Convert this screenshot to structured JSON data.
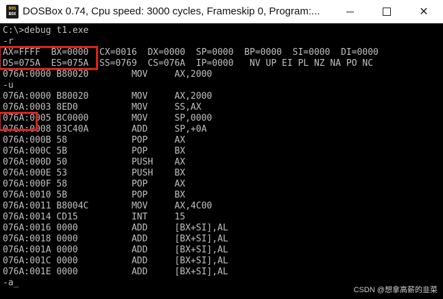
{
  "window": {
    "title": "DOSBox 0.74, Cpu speed:     3000 cycles, Frameskip  0, Program:...",
    "icon_top": "DOS",
    "icon_bottom": "BOX",
    "icon": "dosbox-app-icon",
    "controls": {
      "minimize_icon": "minimize-icon",
      "maximize_icon": "maximize-icon",
      "close_icon": "close-icon",
      "close_glyph": "✕"
    }
  },
  "console_lines": [
    "C:\\>debug t1.exe",
    "-r",
    "AX=FFFF  BX=0000  CX=0016  DX=0000  SP=0000  BP=0000  SI=0000  DI=0000",
    "DS=075A  ES=075A  SS=0769  CS=076A  IP=0000   NV UP EI PL NZ NA PO NC",
    "076A:0000 B80020        MOV     AX,2000",
    "-u",
    "076A:0000 B80020        MOV     AX,2000",
    "076A:0003 8ED0          MOV     SS,AX",
    "076A:0005 BC0000        MOV     SP,0000",
    "076A:0008 83C40A        ADD     SP,+0A",
    "076A:000B 58            POP     AX",
    "076A:000C 5B            POP     BX",
    "076A:000D 50            PUSH    AX",
    "076A:000E 53            PUSH    BX",
    "076A:000F 58            POP     AX",
    "076A:0010 5B            POP     BX",
    "076A:0011 B8004C        MOV     AX,4C00",
    "076A:0014 CD15          INT     15",
    "076A:0016 0000          ADD     [BX+SI],AL",
    "076A:0018 0000          ADD     [BX+SI],AL",
    "076A:001A 0000          ADD     [BX+SI],AL",
    "076A:001C 0000          ADD     [BX+SI],AL",
    "076A:001E 0000          ADD     [BX+SI],AL",
    "-a_"
  ],
  "annotations": {
    "color": "#e0201e"
  },
  "watermark": "CSDN @想拿高薪的韭菜",
  "colors": {
    "console_bg": "#000000",
    "console_fg": "#c0c0c0",
    "titlebar_bg": "#ffffff"
  }
}
